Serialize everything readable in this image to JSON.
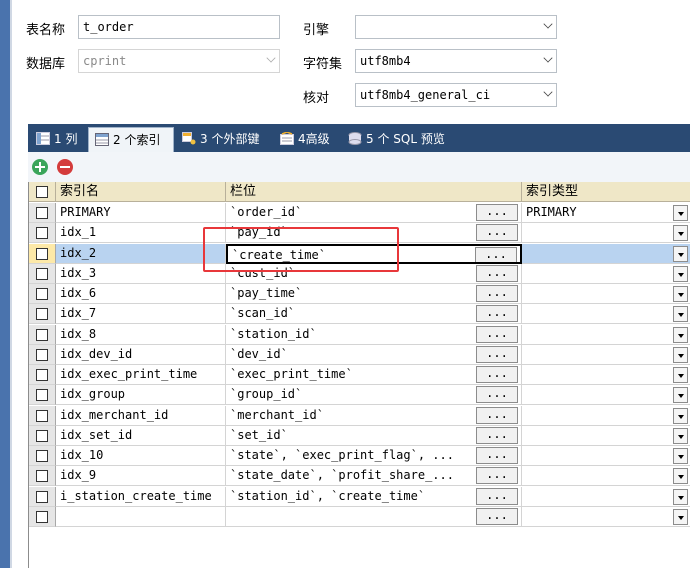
{
  "form": {
    "table_name_label": "表名称",
    "table_name_value": "t_order",
    "database_label": "数据库",
    "database_value": "cprint",
    "engine_label": "引擎",
    "engine_value": "",
    "charset_label": "字符集",
    "charset_value": "utf8mb4",
    "collation_label": "核对",
    "collation_value": "utf8mb4_general_ci"
  },
  "tabs": [
    {
      "label": "1 列",
      "icon": "columns-icon",
      "active": false
    },
    {
      "label": "2 个索引",
      "icon": "index-icon",
      "active": true
    },
    {
      "label": "3 个外部键",
      "icon": "foreign-key-icon",
      "active": false
    },
    {
      "label": "4高级",
      "icon": "advanced-icon",
      "active": false
    },
    {
      "label": "5 个 SQL 预览",
      "icon": "sql-preview-icon",
      "active": false
    }
  ],
  "toolbar": {
    "add_icon": "add-icon",
    "remove_icon": "remove-icon"
  },
  "grid": {
    "headers": [
      "索引名",
      "栏位",
      "索引类型"
    ],
    "dots_label": "...",
    "rows": [
      {
        "name": "PRIMARY",
        "columns": "`order_id`",
        "type": "PRIMARY"
      },
      {
        "name": "idx_1",
        "columns": "`pay_id`",
        "type": ""
      },
      {
        "name": "idx_2",
        "columns": "`create_time`",
        "type": "",
        "selected": true
      },
      {
        "name": "idx_3",
        "columns": "`cust_id`",
        "type": ""
      },
      {
        "name": "idx_6",
        "columns": "`pay_time`",
        "type": ""
      },
      {
        "name": "idx_7",
        "columns": "`scan_id`",
        "type": ""
      },
      {
        "name": "idx_8",
        "columns": "`station_id`",
        "type": ""
      },
      {
        "name": "idx_dev_id",
        "columns": "`dev_id`",
        "type": ""
      },
      {
        "name": "idx_exec_print_time",
        "columns": "`exec_print_time`",
        "type": ""
      },
      {
        "name": "idx_group",
        "columns": "`group_id`",
        "type": ""
      },
      {
        "name": "idx_merchant_id",
        "columns": "`merchant_id`",
        "type": ""
      },
      {
        "name": "idx_set_id",
        "columns": "`set_id`",
        "type": ""
      },
      {
        "name": "idx_10",
        "columns": "`state`, `exec_print_flag`, ...",
        "type": ""
      },
      {
        "name": "idx_9",
        "columns": "`state_date`, `profit_share_...",
        "type": ""
      },
      {
        "name": "i_station_create_time",
        "columns": "`station_id`, `create_time`",
        "type": ""
      },
      {
        "name": "",
        "columns": "",
        "type": ""
      }
    ]
  },
  "colors": {
    "tab_bar": "#2a4a73",
    "header": "#efe7c7",
    "selection": "#b9d3f0",
    "annotation": "#e8373a"
  }
}
